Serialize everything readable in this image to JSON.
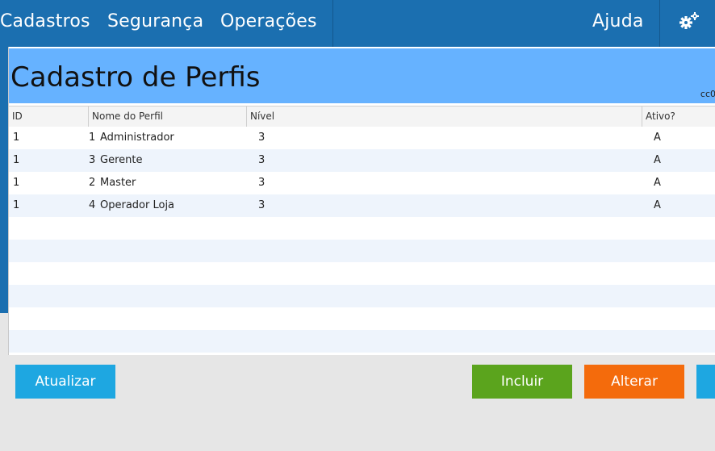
{
  "menu": {
    "items": [
      {
        "label": "Cadastros"
      },
      {
        "label": "Segurança"
      },
      {
        "label": "Operações"
      }
    ],
    "help_label": "Ajuda",
    "settings_icon": "gears-icon"
  },
  "panel": {
    "title": "Cadastro de Perfis",
    "code": "cc0"
  },
  "table": {
    "columns": [
      "ID",
      "Nome do Perfil",
      "Nível",
      "Ativo?"
    ],
    "rows": [
      {
        "id": "1",
        "num": "1",
        "name": "Administrador",
        "nivel": "3",
        "ativo": "A"
      },
      {
        "id": "1",
        "num": "3",
        "name": "Gerente",
        "nivel": "3",
        "ativo": "A"
      },
      {
        "id": "1",
        "num": "2",
        "name": "Master",
        "nivel": "3",
        "ativo": "A"
      },
      {
        "id": "1",
        "num": "4",
        "name": "Operador Loja",
        "nivel": "3",
        "ativo": "A"
      }
    ]
  },
  "buttons": {
    "atualizar": "Atualizar",
    "incluir": "Incluir",
    "alterar": "Alterar"
  },
  "colors": {
    "topbar": "#1b6fb0",
    "header": "#66b2ff",
    "atualizar": "#1ea7e1",
    "incluir": "#5ba41d",
    "alterar": "#f46b0c"
  }
}
